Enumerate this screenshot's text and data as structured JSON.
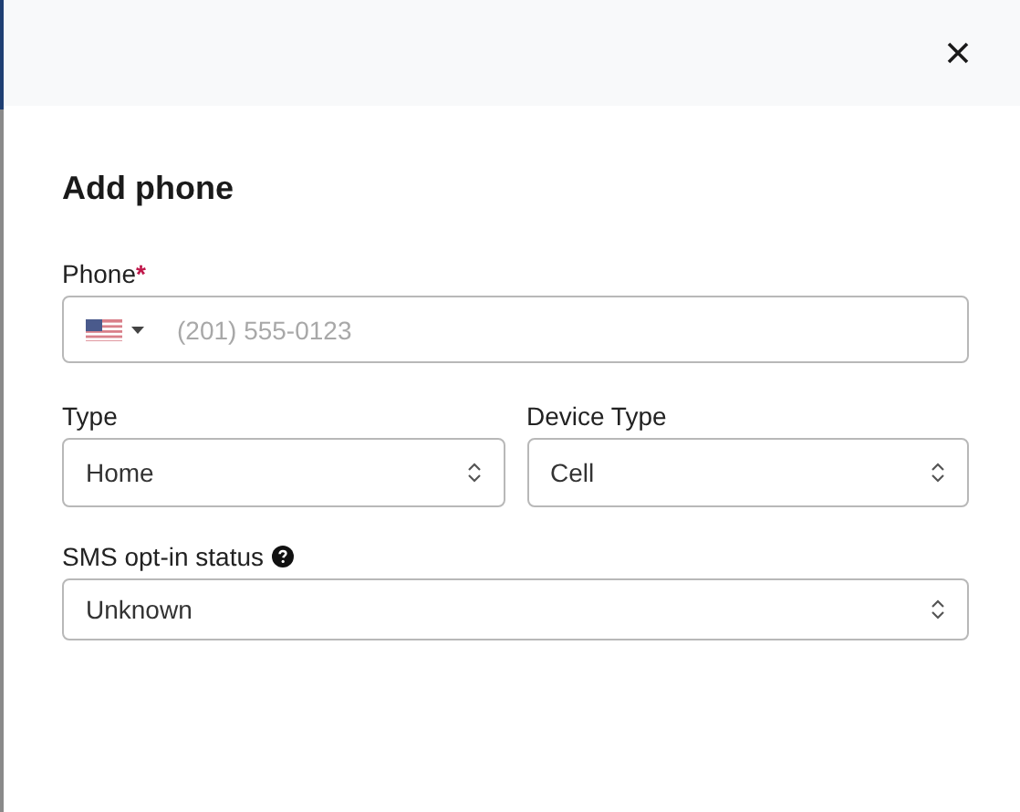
{
  "dialog": {
    "title": "Add phone"
  },
  "phone": {
    "label": "Phone",
    "required_mark": "*",
    "placeholder": "(201) 555-0123"
  },
  "selects": [
    {
      "label": "Type",
      "value": "Home"
    },
    {
      "label": "Device Type",
      "value": "Cell"
    }
  ],
  "sms": {
    "label": "SMS opt-in status",
    "value": "Unknown",
    "help": true
  }
}
